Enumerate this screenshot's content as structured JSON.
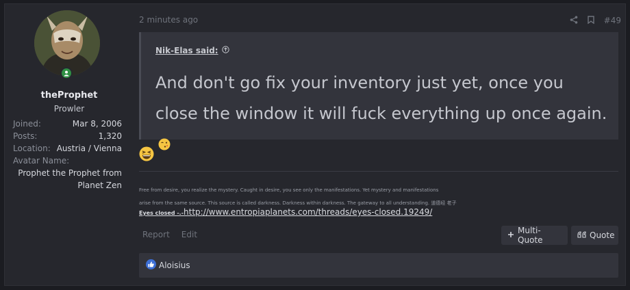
{
  "user": {
    "username": "theProphet",
    "title": "Prowler",
    "stats": [
      {
        "key": "Joined:",
        "value": "Mar 8, 2006"
      },
      {
        "key": "Posts:",
        "value": "1,320"
      },
      {
        "key": "Location:",
        "value": "Austria / Vienna"
      },
      {
        "key": "Avatar Name:",
        "value": ""
      }
    ],
    "avatar_name_lines": [
      "Prophet the Prophet from",
      "Planet Zen"
    ]
  },
  "post": {
    "timestamp": "2 minutes ago",
    "number": "#49",
    "quote": {
      "author": "Nik-Elas said:",
      "text": "And don't go fix your inventory just yet, once you close the window it will fuck everything up once again."
    },
    "signature": {
      "line1": "Free from desire, you realize the mystery. Caught in desire, you see only the manifestations. Yet mystery and manifestations",
      "line2": "arise from the same source. This source is called darkness. Darkness within darkness. The gateway to all understanding. 道德经 老子",
      "link_label": "Eyes closed -.-",
      "link_url": "http://www.entropiaplanets.com/threads/eyes-closed.19249/"
    },
    "actions": {
      "report": "Report",
      "edit": "Edit",
      "multi_quote": "Multi-Quote",
      "quote": "Quote"
    },
    "reactions": {
      "users": "Aloisius"
    }
  },
  "colors": {
    "background": "#1b1c21",
    "card": "#26272d",
    "quote_bg": "#33343c",
    "online": "#2f8f44",
    "like": "#3d6fd6"
  }
}
